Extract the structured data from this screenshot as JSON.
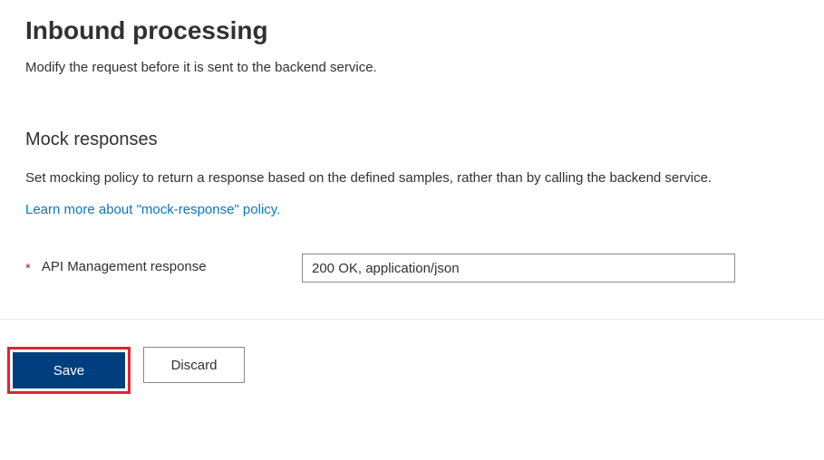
{
  "header": {
    "title": "Inbound processing",
    "description": "Modify the request before it is sent to the backend service."
  },
  "section": {
    "title": "Mock responses",
    "description": "Set mocking policy to return a response based on the defined samples, rather than by calling the backend service.",
    "learn_more_text": "Learn more about \"mock-response\" policy."
  },
  "field": {
    "required_mark": "*",
    "label": "API Management response",
    "value": "200 OK, application/json"
  },
  "buttons": {
    "save_label": "Save",
    "discard_label": "Discard"
  }
}
